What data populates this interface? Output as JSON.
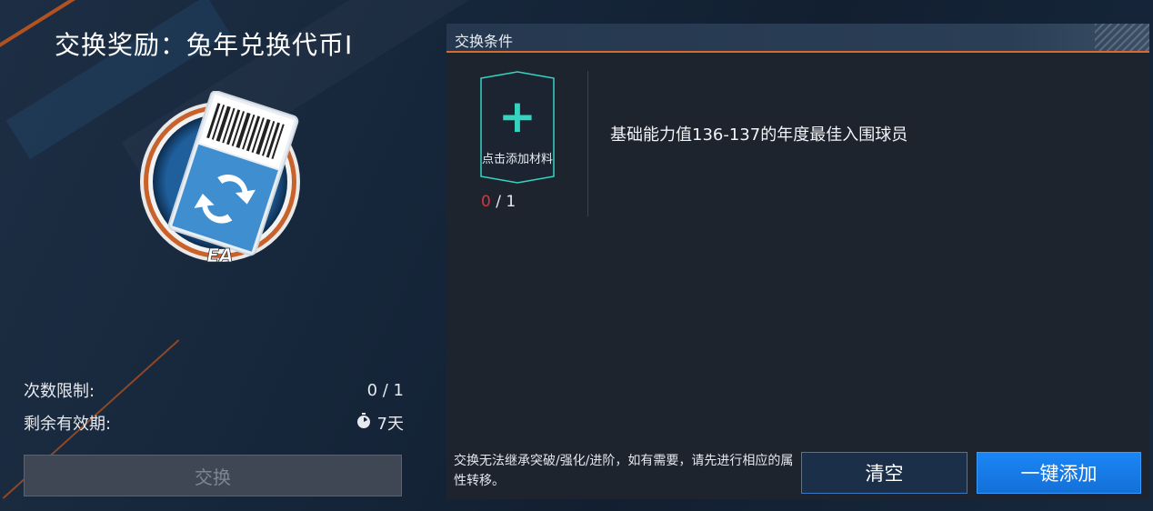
{
  "reward": {
    "title": "交换奖励：兔年兑换代币I",
    "token_icon": "exchange-token-icon",
    "brand": "EA"
  },
  "limits": {
    "count_label": "次数限制:",
    "count_value": "0 / 1",
    "validity_label": "剩余有效期:",
    "validity_value": "7天",
    "validity_icon": "stopwatch-icon"
  },
  "actions": {
    "exchange_label": "交换"
  },
  "conditions_panel": {
    "title": "交换条件",
    "slot": {
      "label": "点击添加材料",
      "current": "0",
      "separator": " / ",
      "required": "1"
    },
    "condition_text": "基础能力值136-137的年度最佳入围球员",
    "notice": "交换无法继承突破/强化/进阶，如有需要，请先进行相应的属性转移。",
    "clear_label": "清空",
    "auto_add_label": "一键添加"
  },
  "colors": {
    "accent_orange": "#d96a2b",
    "plus_teal": "#35d4c2",
    "count_red": "#e0323a",
    "primary_blue": "#1a86f5"
  }
}
